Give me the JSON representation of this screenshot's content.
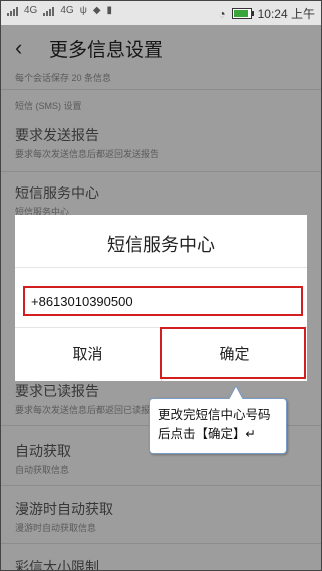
{
  "status_bar": {
    "carrier_1": "4G",
    "carrier_2": "4G",
    "time": "10:24 上午"
  },
  "header": {
    "back_glyph": "‹",
    "title": "更多信息设置"
  },
  "list": {
    "top_partial": "每个会话保存 20 条信息",
    "section_sms": "短信 (SMS) 设置",
    "items": [
      {
        "title": "要求发送报告",
        "subtitle": "要求每次发送信息后都返回发送报告"
      },
      {
        "title": "短信服务中心",
        "subtitle": "短信服务中心"
      },
      {
        "title": "要求已读报告",
        "subtitle": "要求每次发送信息后都返回已读报告"
      },
      {
        "title": "自动获取",
        "subtitle": "自动获取信息"
      },
      {
        "title": "漫游时自动获取",
        "subtitle": "漫游时自动获取信息"
      },
      {
        "title": "彩信大小限制",
        "subtitle": ""
      }
    ]
  },
  "dialog": {
    "title": "短信服务中心",
    "input_value": "+8613010390500",
    "cancel_label": "取消",
    "ok_label": "确定"
  },
  "callout": {
    "text": "更改完短信中心号码后点击【确定】↵"
  },
  "colors": {
    "highlight_red": "#d21e1e",
    "callout_border": "#7a9cc6"
  }
}
